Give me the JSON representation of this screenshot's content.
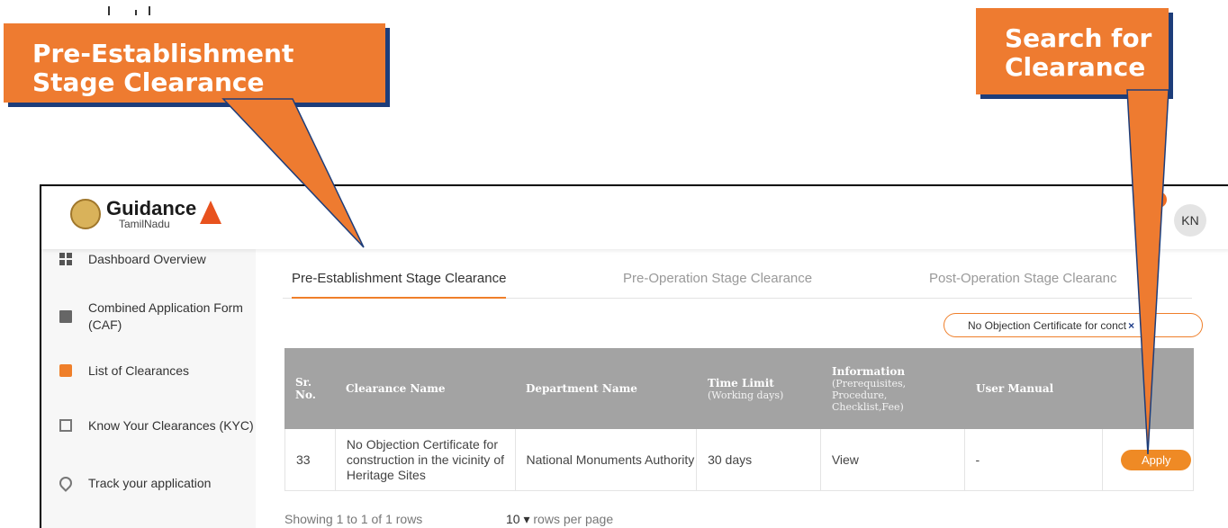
{
  "header": {
    "logo_title": "Guidance",
    "logo_subtitle": "TamilNadu",
    "avatar_initials": "KN"
  },
  "sidebar": {
    "items": [
      {
        "label": "Dashboard Overview",
        "icon": "dashboard-icon"
      },
      {
        "label": "Combined Application Form (CAF)",
        "icon": "document-icon"
      },
      {
        "label": "List of Clearances",
        "icon": "list-icon"
      },
      {
        "label": "Know Your Clearances (KYC)",
        "icon": "book-icon"
      },
      {
        "label": "Track your application",
        "icon": "location-pin-icon"
      }
    ]
  },
  "tabs": [
    {
      "label": "Pre-Establishment Stage Clearance",
      "active": true
    },
    {
      "label": "Pre-Operation Stage Clearance",
      "active": false
    },
    {
      "label": "Post-Operation Stage Clearanc",
      "active": false
    }
  ],
  "search": {
    "value": "No Objection Certificate for con",
    "value_tail": "ct",
    "clear_glyph": "×"
  },
  "table": {
    "headers": {
      "sr_no": "Sr. No.",
      "clearance_name": "Clearance Name",
      "department_name": "Department Name",
      "time_limit": "Time Limit",
      "time_limit_sub": "(Working days)",
      "information": "Information",
      "information_sub": "(Prerequisites, Procedure, Checklist,Fee)",
      "user_manual": "User Manual"
    },
    "rows": [
      {
        "sr_no": "33",
        "clearance_name": "No Objection Certificate for construction in the vicinity of Heritage Sites",
        "department_name": "National Monuments Authority",
        "time_limit": "30 days",
        "information": "View",
        "user_manual": "-",
        "action": "Apply"
      }
    ],
    "footer_showing": "Showing 1 to 1 of 1 rows",
    "rows_per_page_value": "10",
    "rows_per_page_label": "rows per page"
  },
  "callouts": {
    "left_line1": "Pre-Establishment",
    "left_line2": "Stage Clearance",
    "right_line1": "Search for",
    "right_line2": "Clearance"
  },
  "colors": {
    "accent": "#ef7f2a",
    "callout": "#ee7b30",
    "callout_shadow": "#1d3d7a",
    "table_header": "#a3a3a3"
  }
}
